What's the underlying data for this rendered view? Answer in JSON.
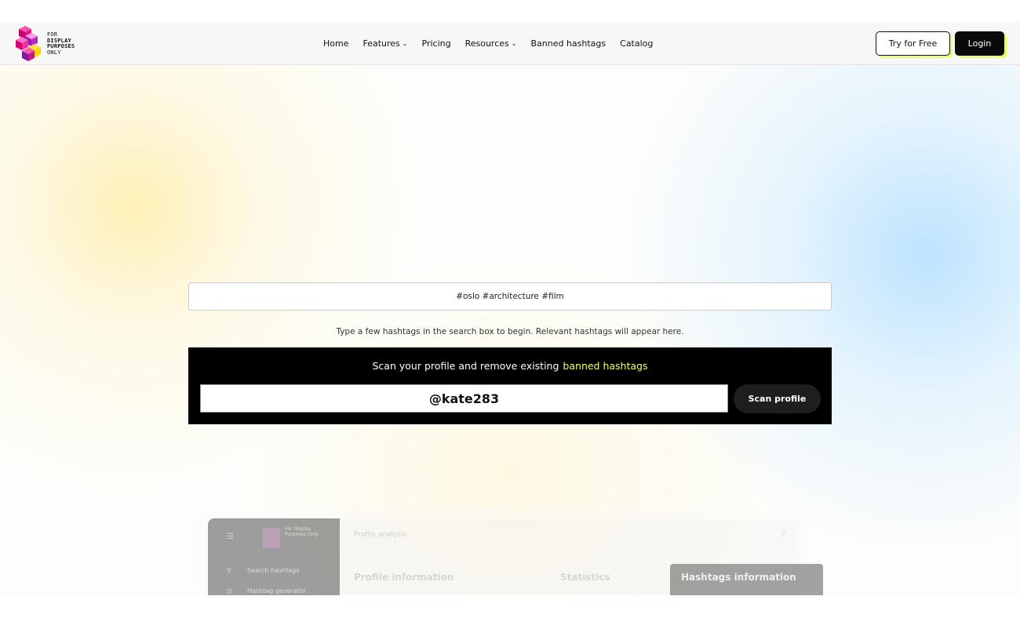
{
  "brand": {
    "logo_lines": [
      "FOR",
      "DISPLAY",
      "PURPOSES",
      "ONLY"
    ],
    "logo_colors": [
      "#e0148c",
      "#ff7a00",
      "#ffd400",
      "#7b1fa2"
    ]
  },
  "nav": {
    "items": [
      {
        "label": "Home",
        "has_dropdown": false
      },
      {
        "label": "Features",
        "has_dropdown": true
      },
      {
        "label": "Pricing",
        "has_dropdown": false
      },
      {
        "label": "Resources",
        "has_dropdown": true
      },
      {
        "label": "Banned hashtags",
        "has_dropdown": false
      },
      {
        "label": "Catalog",
        "has_dropdown": false
      }
    ],
    "try_free_label": "Try for Free",
    "login_label": "Login"
  },
  "search": {
    "value": "#oslo #architecture #film",
    "hint": "Type a few hashtags in the search box to begin. Relevant hashtags will appear here."
  },
  "scan": {
    "title_prefix": "Scan your profile and remove existing",
    "title_highlight": "banned hashtags",
    "username_value": "@kate283",
    "button_label": "Scan profile"
  },
  "preview": {
    "brand_text": "For Display Purposes Only",
    "header_title": "Profile analysis",
    "sidebar_items": [
      "Search hashtags",
      "Hashtag generator"
    ],
    "section_profile": "Profile information",
    "section_statistics": "Statistics",
    "card_title": "Hashtags information"
  },
  "colors": {
    "accent": "#eaff6a",
    "dark": "#0a0a0a"
  }
}
